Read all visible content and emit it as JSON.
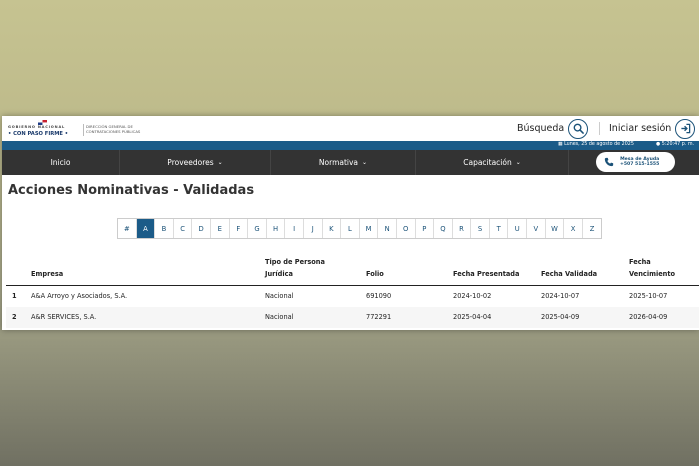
{
  "header": {
    "brand_top": "GOBIERNO NACIONAL",
    "brand_bottom": "• CON PASO FIRME •",
    "directorate": "DIRECCIÓN GENERAL DE CONTRATACIONES PÚBLICAS",
    "search_label": "Búsqueda",
    "login_label": "Iniciar sesión"
  },
  "infobar": {
    "date": "Lunes, 25 de agosto de 2025",
    "time": "5:20:47 p. m."
  },
  "nav": {
    "items": [
      {
        "label": "Inicio",
        "has_dropdown": false
      },
      {
        "label": "Proveedores",
        "has_dropdown": true
      },
      {
        "label": "Normativa",
        "has_dropdown": true
      },
      {
        "label": "Capacitación",
        "has_dropdown": true
      }
    ],
    "help_line1": "Mesa de Ayuda",
    "help_line2": "+507 515-1555"
  },
  "page_title": "Acciones Nominativas - Validadas",
  "alphabet": {
    "letters": [
      "#",
      "A",
      "B",
      "C",
      "D",
      "E",
      "F",
      "G",
      "H",
      "I",
      "J",
      "K",
      "L",
      "M",
      "N",
      "O",
      "P",
      "Q",
      "R",
      "S",
      "T",
      "U",
      "V",
      "W",
      "X",
      "Z"
    ],
    "active": "A"
  },
  "table": {
    "headers": {
      "empresa": "Empresa",
      "tipo_line1": "Tipo de Persona",
      "tipo_line2": "Jurídica",
      "folio": "Folio",
      "fecha_presentada": "Fecha Presentada",
      "fecha_validada": "Fecha Validada",
      "venc_line1": "Fecha",
      "venc_line2": "Vencimiento"
    },
    "rows": [
      {
        "num": "1",
        "empresa": "A&A Arroyo y Asociados, S.A.",
        "tipo": "Nacional",
        "folio": "691090",
        "presentada": "2024-10-02",
        "validada": "2024-10-07",
        "vencimiento": "2025-10-07"
      },
      {
        "num": "2",
        "empresa": "A&R SERVICES, S.A.",
        "tipo": "Nacional",
        "folio": "772291",
        "presentada": "2025-04-04",
        "validada": "2025-04-09",
        "vencimiento": "2026-04-09"
      }
    ]
  },
  "colors": {
    "primary": "#1b5b88",
    "navbar": "#333333",
    "accent_dark": "#1b5278"
  }
}
